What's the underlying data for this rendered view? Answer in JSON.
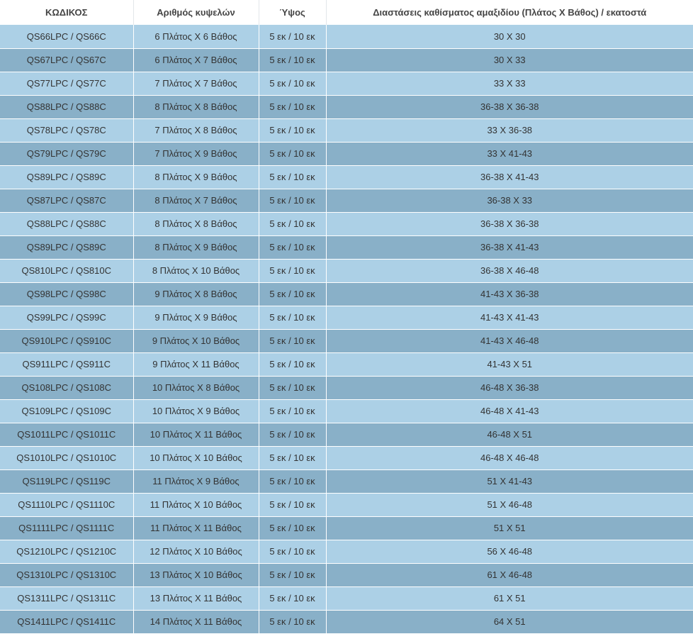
{
  "table": {
    "headers": [
      "ΚΩΔΙΚΟΣ",
      "Αριθμός κυψελών",
      "Ύψος",
      "Διαστάσεις καθίσματος αμαξιδίου (Πλάτος Χ Βάθος) / εκατοστά"
    ],
    "rows": [
      [
        "QS66LPC / QS66C",
        "6 Πλάτος Χ 6 Βάθος",
        "5 εκ / 10 εκ",
        "30 Χ 30"
      ],
      [
        "QS67LPC / QS67C",
        "6 Πλάτος Χ 7 Βάθος",
        "5 εκ / 10 εκ",
        "30 Χ 33"
      ],
      [
        "QS77LPC / QS77C",
        "7 Πλάτος Χ 7 Βάθος",
        "5 εκ / 10 εκ",
        "33 Χ 33"
      ],
      [
        "QS88LPC / QS88C",
        "8 Πλάτος Χ 8 Βάθος",
        "5 εκ / 10 εκ",
        "36-38 Χ 36-38"
      ],
      [
        "QS78LPC / QS78C",
        "7 Πλάτος Χ 8 Βάθος",
        "5 εκ / 10 εκ",
        "33 Χ 36-38"
      ],
      [
        "QS79LPC / QS79C",
        "7 Πλάτος Χ 9 Βάθος",
        "5 εκ / 10 εκ",
        "33 Χ 41-43"
      ],
      [
        "QS89LPC / QS89C",
        "8 Πλάτος Χ 9 Βάθος",
        "5 εκ / 10 εκ",
        "36-38 Χ 41-43"
      ],
      [
        "QS87LPC / QS87C",
        "8 Πλάτος Χ 7 Βάθος",
        "5 εκ / 10 εκ",
        "36-38 Χ 33"
      ],
      [
        "QS88LPC / QS88C",
        "8 Πλάτος Χ 8 Βάθος",
        "5 εκ / 10 εκ",
        "36-38 Χ 36-38"
      ],
      [
        "QS89LPC / QS89C",
        "8 Πλάτος Χ 9 Βάθος",
        "5 εκ / 10 εκ",
        "36-38 Χ 41-43"
      ],
      [
        "QS810LPC / QS810C",
        "8 Πλάτος Χ 10 Βάθος",
        "5 εκ / 10 εκ",
        "36-38 Χ 46-48"
      ],
      [
        "QS98LPC / QS98C",
        "9 Πλάτος Χ 8 Βάθος",
        "5 εκ / 10 εκ",
        "41-43 Χ 36-38"
      ],
      [
        "QS99LPC / QS99C",
        "9 Πλάτος Χ 9 Βάθος",
        "5 εκ / 10 εκ",
        "41-43 Χ 41-43"
      ],
      [
        "QS910LPC / QS910C",
        "9 Πλάτος Χ 10 Βάθος",
        "5 εκ / 10 εκ",
        "41-43 Χ 46-48"
      ],
      [
        "QS911LPC / QS911C",
        "9 Πλάτος Χ 11 Βάθος",
        "5 εκ / 10 εκ",
        "41-43 Χ 51"
      ],
      [
        "QS108LPC / QS108C",
        "10 Πλάτος Χ 8 Βάθος",
        "5 εκ / 10 εκ",
        "46-48 Χ 36-38"
      ],
      [
        "QS109LPC / QS109C",
        "10 Πλάτος Χ 9 Βάθος",
        "5 εκ / 10 εκ",
        "46-48 Χ 41-43"
      ],
      [
        "QS1011LPC / QS1011C",
        "10 Πλάτος Χ 11 Βάθος",
        "5 εκ / 10 εκ",
        "46-48 Χ 51"
      ],
      [
        "QS1010LPC / QS1010C",
        "10 Πλάτος Χ 10 Βάθος",
        "5 εκ / 10 εκ",
        "46-48 Χ 46-48"
      ],
      [
        "QS119LPC / QS119C",
        "11 Πλάτος Χ 9 Βάθος",
        "5 εκ / 10 εκ",
        "51 Χ 41-43"
      ],
      [
        "QS1110LPC / QS1110C",
        "11 Πλάτος Χ 10 Βάθος",
        "5 εκ / 10 εκ",
        "51 Χ 46-48"
      ],
      [
        "QS1111LPC / QS1111C",
        "11 Πλάτος Χ 11 Βάθος",
        "5 εκ / 10 εκ",
        "51 Χ 51"
      ],
      [
        "QS1210LPC / QS1210C",
        "12 Πλάτος Χ 10 Βάθος",
        "5 εκ / 10 εκ",
        "56 Χ 46-48"
      ],
      [
        "QS1310LPC / QS1310C",
        "13 Πλάτος Χ 10 Βάθος",
        "5 εκ / 10 εκ",
        "61 Χ 46-48"
      ],
      [
        "QS1311LPC / QS1311C",
        "13 Πλάτος Χ 11 Βάθος",
        "5 εκ / 10 εκ",
        "61 Χ 51"
      ],
      [
        "QS1411LPC / QS1411C",
        "14 Πλάτος Χ 11 Βάθος",
        "5 εκ / 10 εκ",
        "64 Χ 51"
      ]
    ]
  },
  "colors": {
    "row_light": "#acd0e6",
    "row_dark": "#89b0c8",
    "header_bg": "#ffffff",
    "text": "#333333"
  }
}
